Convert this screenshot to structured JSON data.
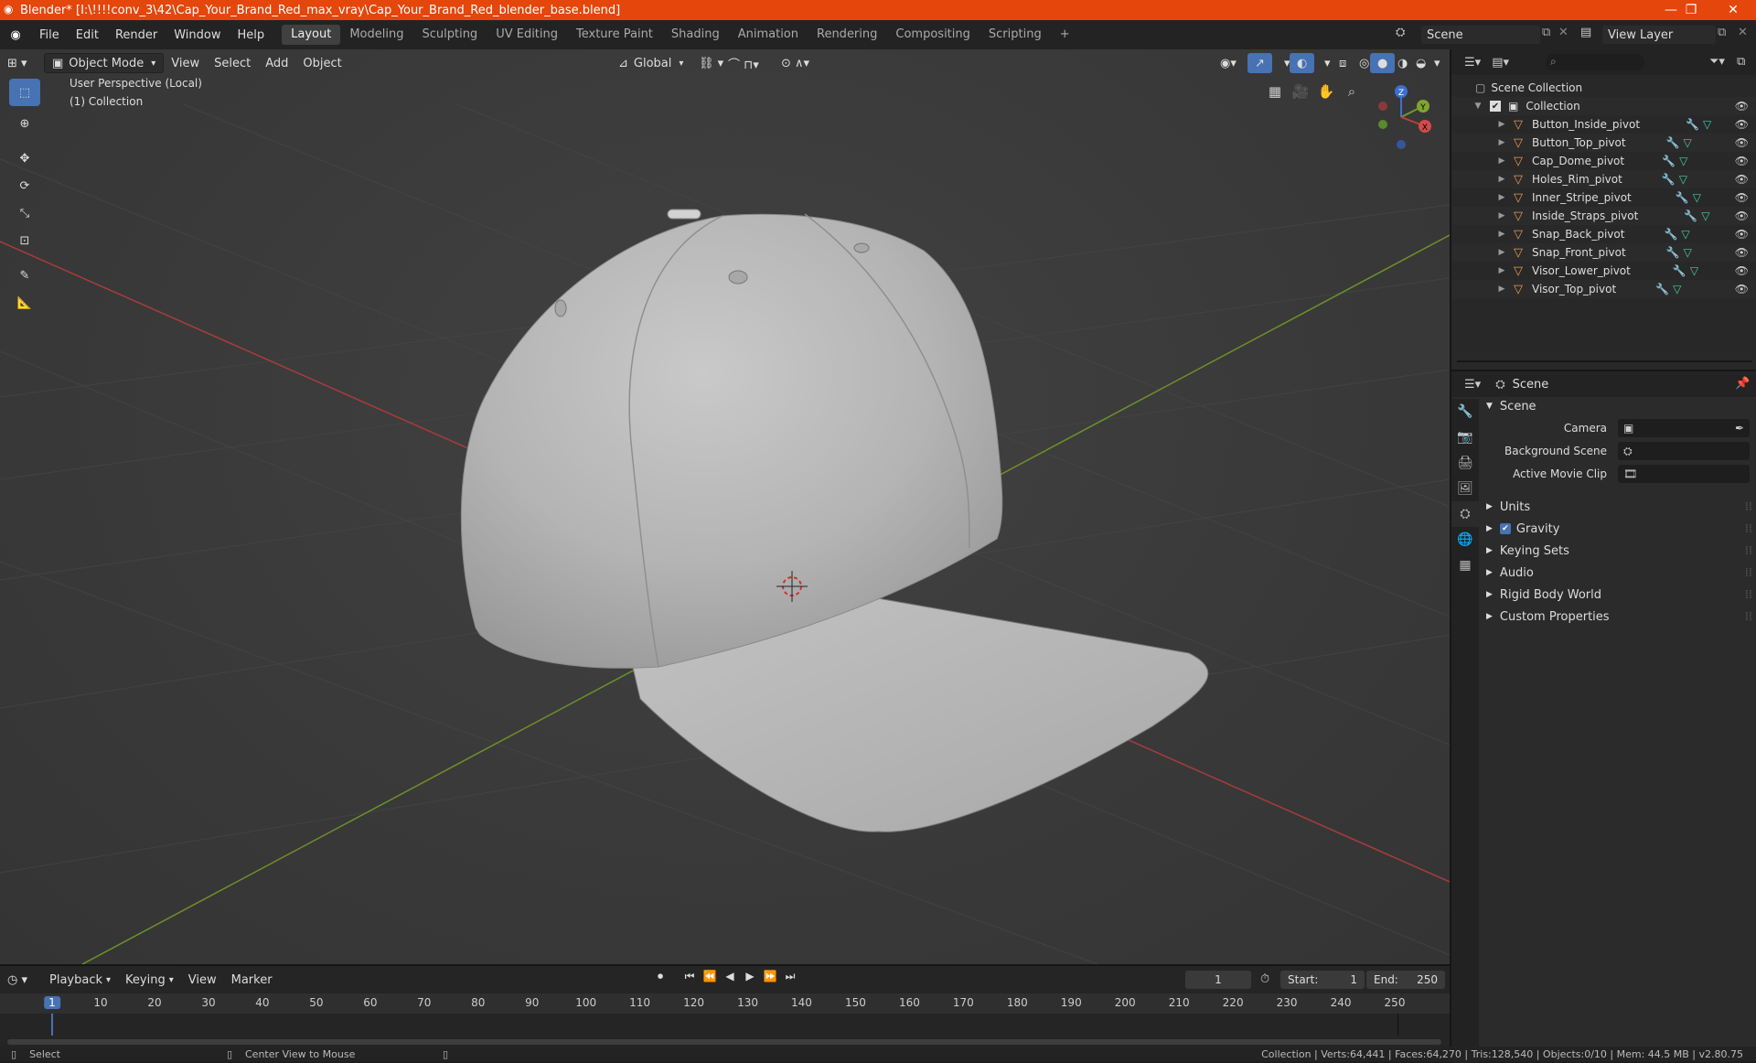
{
  "window": {
    "title": "Blender* [I:\\!!!!conv_3\\42\\Cap_Your_Brand_Red_max_vray\\Cap_Your_Brand_Red_blender_base.blend]",
    "minimize": "—",
    "maximize": "❐",
    "close": "✕"
  },
  "menu": {
    "items": [
      "File",
      "Edit",
      "Render",
      "Window",
      "Help"
    ]
  },
  "workspaces": [
    "Layout",
    "Modeling",
    "Sculpting",
    "UV Editing",
    "Texture Paint",
    "Shading",
    "Animation",
    "Rendering",
    "Compositing",
    "Scripting"
  ],
  "workspace_add": "+",
  "scene_selector": {
    "value": "Scene"
  },
  "view_layer_selector": {
    "value": "View Layer"
  },
  "viewport": {
    "mode": "Object Mode",
    "menus": [
      "View",
      "Select",
      "Add",
      "Object"
    ],
    "transform_orientation": "Global",
    "overlay_text_1": "User Perspective (Local)",
    "overlay_text_2": "(1) Collection",
    "gizmo_axes": {
      "x": "X",
      "y": "Y",
      "z": "Z"
    }
  },
  "outliner": {
    "search_placeholder": "",
    "root": "Scene Collection",
    "collection": "Collection",
    "objects": [
      "Button_Inside_pivot",
      "Button_Top_pivot",
      "Cap_Dome_pivot",
      "Holes_Rim_pivot",
      "Inner_Stripe_pivot",
      "Inside_Straps_pivot",
      "Snap_Back_pivot",
      "Snap_Front_pivot",
      "Visor_Lower_pivot",
      "Visor_Top_pivot"
    ]
  },
  "properties": {
    "context": "Scene",
    "panel": "Scene",
    "camera_label": "Camera",
    "background_scene_label": "Background Scene",
    "active_movie_clip_label": "Active Movie Clip",
    "sections": [
      "Units",
      "Gravity",
      "Keying Sets",
      "Audio",
      "Rigid Body World",
      "Custom Properties"
    ],
    "gravity_checked": true
  },
  "timeline": {
    "menus": [
      "Playback",
      "Keying",
      "View",
      "Marker"
    ],
    "current_frame": "1",
    "start_label": "Start:",
    "start": "1",
    "end_label": "End:",
    "end": "250",
    "ticks": [
      "1",
      "10",
      "20",
      "30",
      "40",
      "50",
      "60",
      "70",
      "80",
      "90",
      "100",
      "110",
      "120",
      "130",
      "140",
      "150",
      "160",
      "170",
      "180",
      "190",
      "200",
      "210",
      "220",
      "230",
      "240",
      "250"
    ]
  },
  "status": {
    "left_action": "Select",
    "middle_action": "Center View to Mouse",
    "stats": "Collection | Verts:64,441 | Faces:64,270 | Tris:128,540 | Objects:0/10 | Mem: 44.5 MB | v2.80.75"
  },
  "colors": {
    "titlebar": "#e4460c",
    "accent": "#4772b3",
    "x_axis": "#a83c3c",
    "y_axis": "#6f8f2a",
    "mesh_icon": "#e89a52"
  },
  "icons": {
    "blender_logo": "blender-logo-icon",
    "mesh": "mesh-triangle-icon",
    "modifier": "wrench-icon",
    "data": "mesh-data-icon",
    "visibility": "eye-icon"
  }
}
